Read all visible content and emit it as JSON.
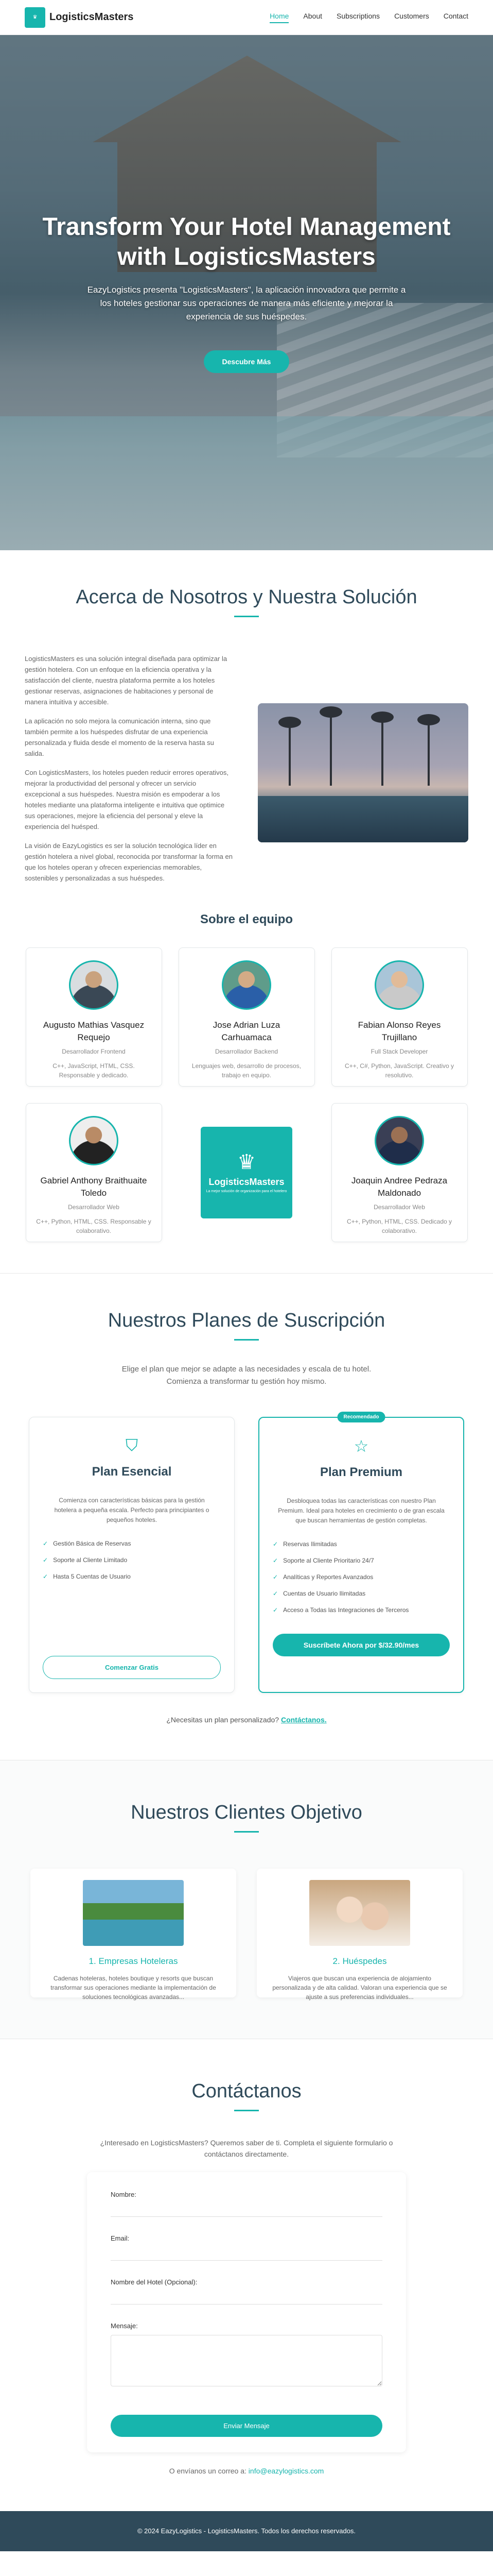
{
  "nav": {
    "brand": "LogisticsMasters",
    "links": [
      "Home",
      "About",
      "Subscriptions",
      "Customers",
      "Contact"
    ]
  },
  "hero": {
    "title": "Transform Your Hotel Management with LogisticsMasters",
    "subtitle": "EazyLogistics presenta \"LogisticsMasters\", la aplicación innovadora que permite a los hoteles gestionar sus operaciones de manera más eficiente y mejorar la experiencia de sus huéspedes.",
    "cta": "Descubre Más"
  },
  "about": {
    "title": "Acerca de Nosotros y Nuestra Solución",
    "paragraphs": [
      "LogisticsMasters es una solución integral diseñada para optimizar la gestión hotelera. Con un enfoque en la eficiencia operativa y la satisfacción del cliente, nuestra plataforma permite a los hoteles gestionar reservas, asignaciones de habitaciones y personal de manera intuitiva y accesible.",
      "La aplicación no solo mejora la comunicación interna, sino que también permite a los huéspedes disfrutar de una experiencia personalizada y fluida desde el momento de la reserva hasta su salida.",
      "Con LogisticsMasters, los hoteles pueden reducir errores operativos, mejorar la productividad del personal y ofrecer un servicio excepcional a sus huéspedes. Nuestra misión es empoderar a los hoteles mediante una plataforma inteligente e intuitiva que optimice sus operaciones, mejore la eficiencia del personal y eleve la experiencia del huésped.",
      "La visión de EazyLogistics es ser la solución tecnológica líder en gestión hotelera a nivel global, reconocida por transformar la forma en que los hoteles operan y ofrecen experiencias memorables, sostenibles y personalizadas a sus huéspedes."
    ],
    "team_title": "Sobre el equipo",
    "team": [
      {
        "name": "Augusto Mathias Vasquez Requejo",
        "role": "Desarrollador Frontend",
        "skills": "C++, JavaScript, HTML, CSS. Responsable y dedicado."
      },
      {
        "name": "Jose Adrian Luza Carhuamaca",
        "role": "Desarrollador Backend",
        "skills": "Lenguajes web, desarrollo de procesos, trabajo en equipo."
      },
      {
        "name": "Fabian Alonso Reyes Trujillano",
        "role": "Full Stack Developer",
        "skills": "C++, C#, Python, JavaScript. Creativo y resolutivo."
      },
      {
        "name": "Gabriel Anthony Braithuaite Toledo",
        "role": "Desarrollador Web",
        "skills": "C++, Python, HTML, CSS. Responsable y colaborativo."
      },
      {
        "name": "Joaquin Andree Pedraza Maldonado",
        "role": "Desarrollador Web",
        "skills": "C++, Python, HTML, CSS. Dedicado y colaborativo."
      }
    ],
    "logo_text": "LogisticsMasters",
    "logo_tagline": "La mejor solución de organización para el hotelero"
  },
  "plans": {
    "title": "Nuestros Planes de Suscripción",
    "lead": "Elige el plan que mejor se adapte a las necesidades y escala de tu hotel. Comienza a transformar tu gestión hoy mismo.",
    "basic": {
      "name": "Plan Esencial",
      "desc": "Comienza con características básicas para la gestión hotelera a pequeña escala. Perfecto para principiantes o pequeños hoteles.",
      "features": [
        "Gestión Básica de Reservas",
        "Soporte al Cliente Limitado",
        "Hasta 5 Cuentas de Usuario"
      ],
      "button": "Comenzar Gratis"
    },
    "premium": {
      "badge": "Recomendado",
      "name": "Plan Premium",
      "desc": "Desbloquea todas las características con nuestro Plan Premium. Ideal para hoteles en crecimiento o de gran escala que buscan herramientas de gestión completas.",
      "features": [
        "Reservas Ilimitadas",
        "Soporte al Cliente Prioritario 24/7",
        "Analíticas y Reportes Avanzados",
        "Cuentas de Usuario Ilimitadas",
        "Acceso a Todas las Integraciones de Terceros"
      ],
      "button": "Suscríbete Ahora por $/32.90/mes"
    },
    "custom_q": "¿Necesitas un plan personalizado?",
    "custom_link": "Contáctanos."
  },
  "clients": {
    "title": "Nuestros Clientes Objetivo",
    "items": [
      {
        "title": "1. Empresas Hoteleras",
        "text": "Cadenas hoteleras, hoteles boutique y resorts que buscan transformar sus operaciones mediante la implementación de soluciones tecnológicas avanzadas..."
      },
      {
        "title": "2. Huéspedes",
        "text": "Viajeros que buscan una experiencia de alojamiento personalizada y de alta calidad. Valoran una experiencia que se ajuste a sus preferencias individuales..."
      }
    ]
  },
  "contact": {
    "title": "Contáctanos",
    "lead": "¿Interesado en LogisticsMasters? Queremos saber de ti. Completa el siguiente formulario o contáctanos directamente.",
    "labels": {
      "name": "Nombre:",
      "email": "Email:",
      "hotel": "Nombre del Hotel (Opcional):",
      "message": "Mensaje:"
    },
    "submit": "Enviar Mensaje",
    "mail_prefix": "O envíanos un correo a:",
    "mail": "info@eazylogistics.com"
  },
  "footer": "© 2024 EazyLogistics - LogisticsMasters. Todos los derechos reservados."
}
